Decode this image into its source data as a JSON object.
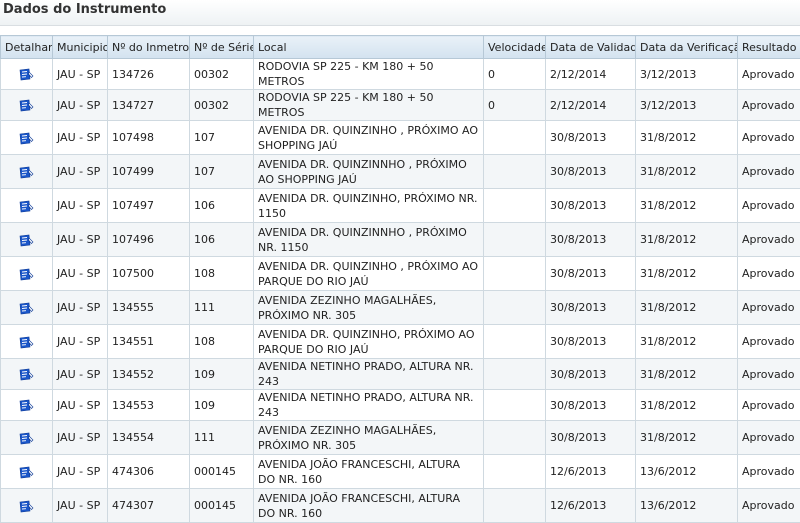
{
  "section_title": "Dados do Instrumento",
  "columns": [
    "Detalhar",
    "Municipio",
    "Nº do Inmetro",
    "Nº de Série",
    "Local",
    "Velocidade",
    "Data de Validade",
    "Data da Verificação",
    "Resultado"
  ],
  "detail_icon": "edit-document-icon",
  "accent": "#1a56c9",
  "rows": [
    {
      "municipio": "JAU - SP",
      "inmetro": "134726",
      "serie": "00302",
      "local": "RODOVIA SP 225 - KM 180 + 50 METROS",
      "velocidade": "0",
      "validade": "2/12/2014",
      "verificacao": "3/12/2013",
      "resultado": "Aprovado"
    },
    {
      "municipio": "JAU - SP",
      "inmetro": "134727",
      "serie": "00302",
      "local": "RODOVIA SP 225 - KM 180 + 50 METROS",
      "velocidade": "0",
      "validade": "2/12/2014",
      "verificacao": "3/12/2013",
      "resultado": "Aprovado"
    },
    {
      "municipio": "JAU - SP",
      "inmetro": "107498",
      "serie": "107",
      "local": "AVENIDA DR. QUINZINHO , PRÓXIMO AO SHOPPING JAÚ",
      "velocidade": "",
      "validade": "30/8/2013",
      "verificacao": "31/8/2012",
      "resultado": "Aprovado"
    },
    {
      "municipio": "JAU - SP",
      "inmetro": "107499",
      "serie": "107",
      "local": "AVENIDA DR. QUINZINNHO , PRÓXIMO AO SHOPPING JAÚ",
      "velocidade": "",
      "validade": "30/8/2013",
      "verificacao": "31/8/2012",
      "resultado": "Aprovado"
    },
    {
      "municipio": "JAU - SP",
      "inmetro": "107497",
      "serie": "106",
      "local": "AVENIDA DR. QUINZINHO, PRÓXIMO NR. 1150",
      "velocidade": "",
      "validade": "30/8/2013",
      "verificacao": "31/8/2012",
      "resultado": "Aprovado"
    },
    {
      "municipio": "JAU - SP",
      "inmetro": "107496",
      "serie": "106",
      "local": "AVENIDA DR. QUINZINNHO , PRÓXIMO NR. 1150",
      "velocidade": "",
      "validade": "30/8/2013",
      "verificacao": "31/8/2012",
      "resultado": "Aprovado"
    },
    {
      "municipio": "JAU - SP",
      "inmetro": "107500",
      "serie": "108",
      "local": "AVENIDA DR. QUINZINHO , PRÓXIMO AO PARQUE DO RIO JAÚ",
      "velocidade": "",
      "validade": "30/8/2013",
      "verificacao": "31/8/2012",
      "resultado": "Aprovado"
    },
    {
      "municipio": "JAU - SP",
      "inmetro": "134555",
      "serie": "111",
      "local": "AVENIDA ZEZINHO MAGALHÃES, PRÓXIMO NR. 305",
      "velocidade": "",
      "validade": "30/8/2013",
      "verificacao": "31/8/2012",
      "resultado": "Aprovado"
    },
    {
      "municipio": "JAU - SP",
      "inmetro": "134551",
      "serie": "108",
      "local": "AVENIDA DR. QUINZINHO, PRÓXIMO AO PARQUE DO RIO JAÚ",
      "velocidade": "",
      "validade": "30/8/2013",
      "verificacao": "31/8/2012",
      "resultado": "Aprovado"
    },
    {
      "municipio": "JAU - SP",
      "inmetro": "134552",
      "serie": "109",
      "local": "AVENIDA NETINHO PRADO, ALTURA NR. 243",
      "velocidade": "",
      "validade": "30/8/2013",
      "verificacao": "31/8/2012",
      "resultado": "Aprovado"
    },
    {
      "municipio": "JAU - SP",
      "inmetro": "134553",
      "serie": "109",
      "local": "AVENIDA NETINHO PRADO, ALTURA NR. 243",
      "velocidade": "",
      "validade": "30/8/2013",
      "verificacao": "31/8/2012",
      "resultado": "Aprovado"
    },
    {
      "municipio": "JAU - SP",
      "inmetro": "134554",
      "serie": "111",
      "local": "AVENIDA ZEZINHO MAGALHÃES, PRÓXIMO NR. 305",
      "velocidade": "",
      "validade": "30/8/2013",
      "verificacao": "31/8/2012",
      "resultado": "Aprovado"
    },
    {
      "municipio": "JAU - SP",
      "inmetro": "474306",
      "serie": "000145",
      "local": "AVENIDA JOÃO FRANCESCHI, ALTURA DO NR. 160",
      "velocidade": "",
      "validade": "12/6/2013",
      "verificacao": "13/6/2012",
      "resultado": "Aprovado"
    },
    {
      "municipio": "JAU - SP",
      "inmetro": "474307",
      "serie": "000145",
      "local": "AVENIDA JOÃO FRANCESCHI, ALTURA DO NR. 160",
      "velocidade": "",
      "validade": "12/6/2013",
      "verificacao": "13/6/2012",
      "resultado": "Aprovado"
    }
  ]
}
